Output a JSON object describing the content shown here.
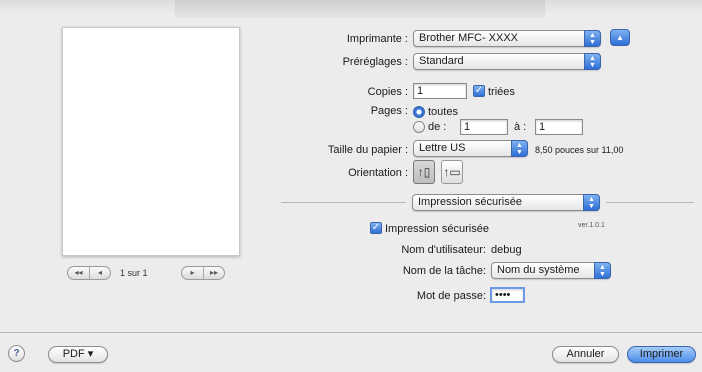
{
  "printer": {
    "label": "Imprimante :",
    "value": "Brother MFC- XXXX"
  },
  "presets": {
    "label": "Préréglages :",
    "value": "Standard"
  },
  "copies": {
    "label": "Copies :",
    "value": "1",
    "collated_label": "triées",
    "collated_checked": true
  },
  "pages": {
    "label": "Pages :",
    "all_label": "toutes",
    "all_selected": true,
    "range_from_label": "de :",
    "range_from_value": "1",
    "range_to_label": "à :",
    "range_to_value": "1"
  },
  "paper_size": {
    "label": "Taille du papier :",
    "value": "Lettre US",
    "dimensions": "8,50 pouces sur 11,00"
  },
  "orientation": {
    "label": "Orientation :",
    "selected": "portrait"
  },
  "panel": {
    "value": "Impression sécurisée"
  },
  "secure_print": {
    "checkbox_label": "Impression sécurisée",
    "checked": true,
    "version": "ver.1.0.1",
    "username_label": "Nom d'utilisateur:",
    "username_value": "debug",
    "job_name_label": "Nom de la tâche:",
    "job_name_value": "Nom du système",
    "password_label": "Mot de passe:",
    "password_value": "••••"
  },
  "preview_nav": {
    "first": "◂◂",
    "prev": "◂",
    "next": "▸",
    "last": "▸▸",
    "page_indicator": "1 sur 1"
  },
  "footer": {
    "help": "?",
    "pdf_label": "PDF ▾",
    "cancel_label": "Annuler",
    "print_label": "Imprimer"
  },
  "colors": {
    "accent": "#3f7fe0",
    "window_bg": "#ececec"
  }
}
